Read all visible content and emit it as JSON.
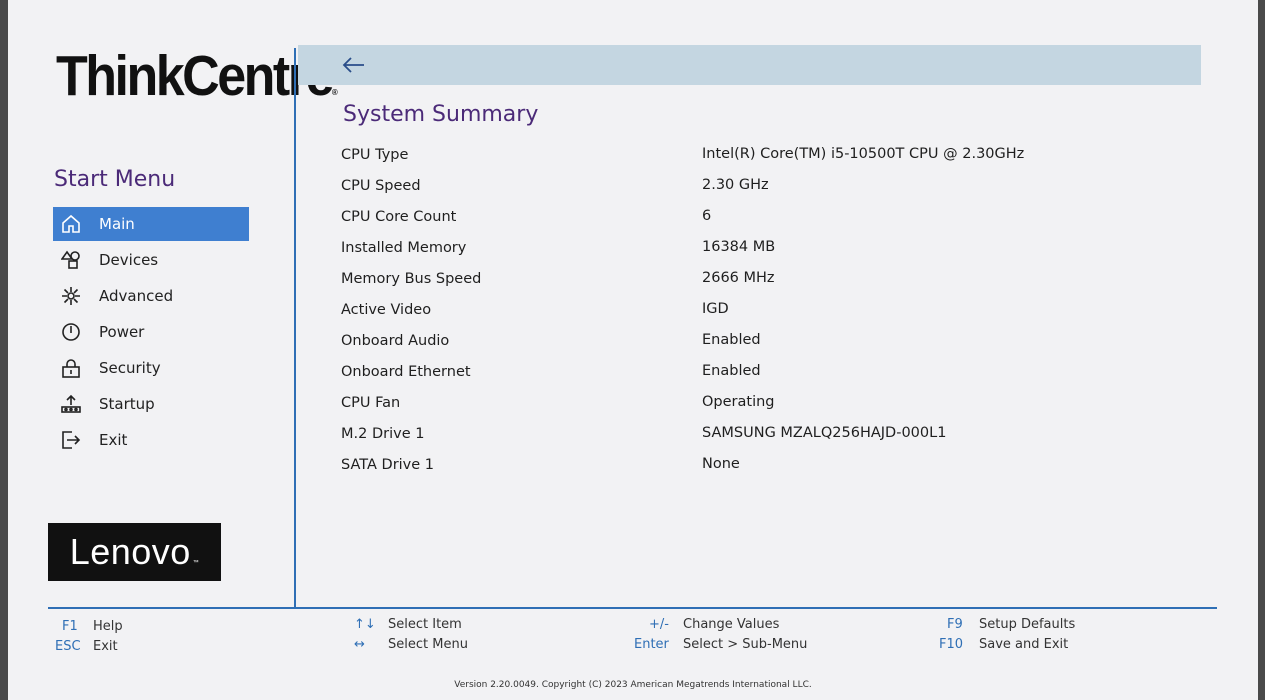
{
  "brand": {
    "product_logo": "ThinkCentre",
    "product_logo_tm": "®",
    "vendor_logo": "Lenovo",
    "vendor_logo_tm": "™"
  },
  "sidebar": {
    "title": "Start Menu",
    "items": [
      {
        "label": "Main",
        "icon": "home-icon",
        "active": true
      },
      {
        "label": "Devices",
        "icon": "devices-icon"
      },
      {
        "label": "Advanced",
        "icon": "advanced-icon"
      },
      {
        "label": "Power",
        "icon": "power-icon"
      },
      {
        "label": "Security",
        "icon": "lock-icon"
      },
      {
        "label": "Startup",
        "icon": "startup-icon"
      },
      {
        "label": "Exit",
        "icon": "exit-icon"
      }
    ]
  },
  "header": {
    "back_icon": "back-arrow-icon"
  },
  "main": {
    "title": "System Summary",
    "rows": [
      {
        "label": "CPU Type",
        "value": "Intel(R) Core(TM) i5-10500T CPU @ 2.30GHz"
      },
      {
        "label": "CPU Speed",
        "value": "2.30 GHz"
      },
      {
        "label": "CPU Core Count",
        "value": "6"
      },
      {
        "label": "Installed Memory",
        "value": "16384 MB"
      },
      {
        "label": "Memory Bus Speed",
        "value": "2666 MHz"
      },
      {
        "label": "Active Video",
        "value": "IGD"
      },
      {
        "label": "Onboard Audio",
        "value": "Enabled"
      },
      {
        "label": "Onboard Ethernet",
        "value": "Enabled"
      },
      {
        "label": "CPU Fan",
        "value": "Operating"
      },
      {
        "label": "M.2 Drive 1",
        "value": "SAMSUNG MZALQ256HAJD-000L1"
      },
      {
        "label": "SATA Drive 1",
        "value": "None"
      }
    ]
  },
  "footer": {
    "hotkeys": [
      {
        "key": "F1",
        "action": "Help"
      },
      {
        "key": "ESC",
        "action": "Exit"
      },
      {
        "key": "↑↓",
        "action": "Select Item"
      },
      {
        "key": "↔",
        "action": "Select Menu"
      },
      {
        "key": "+/-",
        "action": "Change Values"
      },
      {
        "key": "Enter",
        "action": "Select > Sub-Menu"
      },
      {
        "key": "F9",
        "action": "Setup Defaults"
      },
      {
        "key": "F10",
        "action": "Save and Exit"
      }
    ],
    "version": "Version 2.20.0049. Copyright (C) 2023 American Megatrends International LLC."
  },
  "colors": {
    "accent": "#3f7fd0",
    "title": "#4b2a78",
    "divider": "#2f6fb5",
    "topbar": "#c4d6e1"
  }
}
